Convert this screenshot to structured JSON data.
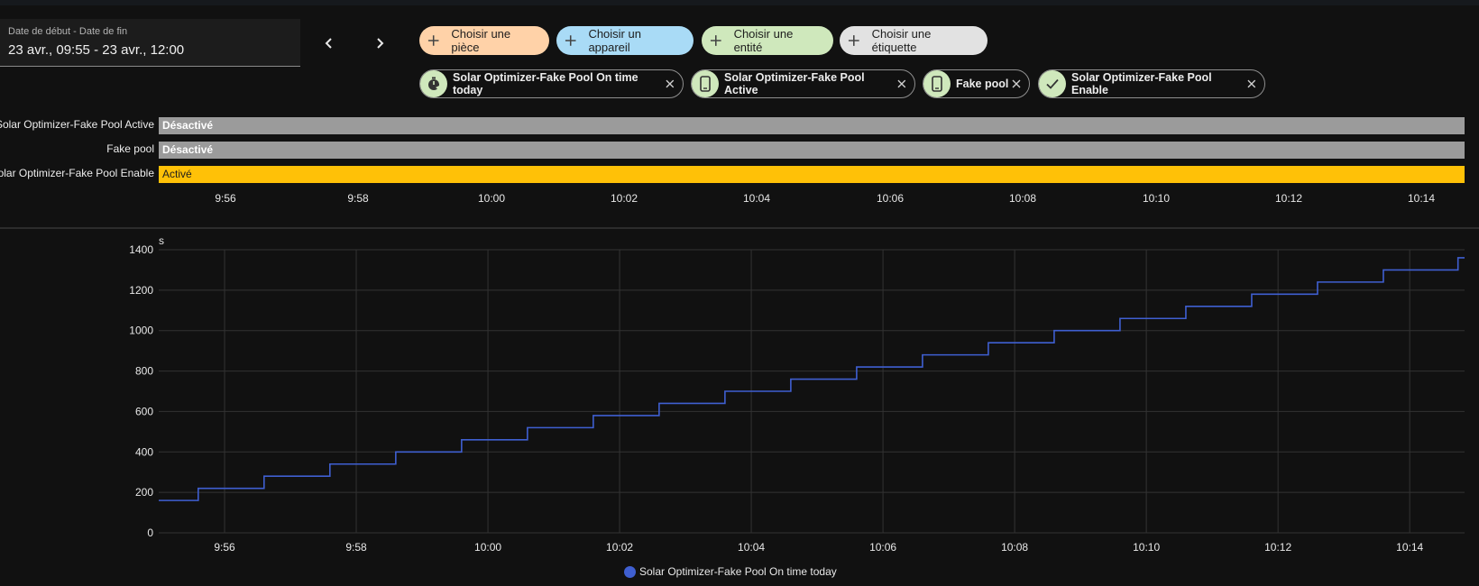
{
  "date_range": {
    "label": "Date de début - Date de fin",
    "value": "23 avr., 09:55 - 23 avr., 12:00"
  },
  "nav": {
    "prev_icon": "chevron-left-icon",
    "next_icon": "chevron-right-icon"
  },
  "pickers": [
    {
      "label": "Choisir une pièce",
      "color": "#ffd2a8"
    },
    {
      "label": "Choisir un appareil",
      "color": "#a9dbf6"
    },
    {
      "label": "Choisir une entité",
      "color": "#cfe8bc"
    },
    {
      "label": "Choisir une étiquette",
      "color": "#e2e2e2"
    }
  ],
  "chips": [
    {
      "label": "Solar Optimizer-Fake Pool On time today",
      "icon": "timer-icon"
    },
    {
      "label": "Solar Optimizer-Fake Pool Active",
      "icon": "device-icon"
    },
    {
      "label": "Fake pool",
      "icon": "device-icon"
    },
    {
      "label": "Solar Optimizer-Fake Pool Enable",
      "icon": "check-icon"
    }
  ],
  "timeline": {
    "rows": [
      {
        "entity": "Solar Optimizer-Fake Pool Active",
        "state": "Désactivé",
        "color": "#9b9b9b"
      },
      {
        "entity": "Fake pool",
        "state": "Désactivé",
        "color": "#9b9b9b"
      },
      {
        "entity": "Solar Optimizer-Fake Pool Enable",
        "state": "Activé",
        "color": "#ffc107"
      }
    ],
    "ticks": [
      "9:56",
      "9:58",
      "10:00",
      "10:02",
      "10:04",
      "10:06",
      "10:08",
      "10:10",
      "10:12",
      "10:14"
    ]
  },
  "chart_data": {
    "type": "line",
    "step": true,
    "unit": "s",
    "ylim": [
      0,
      1400
    ],
    "yticks": [
      0,
      200,
      400,
      600,
      800,
      1000,
      1200,
      1400
    ],
    "xlim": [
      "9:55",
      "10:14:50"
    ],
    "xticks": [
      "9:56",
      "9:58",
      "10:00",
      "10:02",
      "10:04",
      "10:06",
      "10:08",
      "10:10",
      "10:12",
      "10:14"
    ],
    "grid": true,
    "legend_position": "bottom",
    "series": [
      {
        "name": "Solar Optimizer-Fake Pool On time today",
        "color": "#3f5fd1",
        "x": [
          "9:55",
          "9:55:36",
          "9:56:36",
          "9:57:36",
          "9:58:36",
          "9:59:36",
          "10:00:36",
          "10:01:36",
          "10:02:36",
          "10:03:36",
          "10:04:36",
          "10:05:36",
          "10:06:36",
          "10:07:36",
          "10:08:36",
          "10:09:36",
          "10:10:36",
          "10:11:36",
          "10:12:36",
          "10:13:36",
          "10:14:44",
          "10:14:50"
        ],
        "values": [
          160,
          220,
          280,
          340,
          400,
          460,
          520,
          580,
          640,
          700,
          760,
          820,
          880,
          940,
          1000,
          1060,
          1120,
          1180,
          1240,
          1300,
          1360,
          1360
        ]
      }
    ]
  }
}
